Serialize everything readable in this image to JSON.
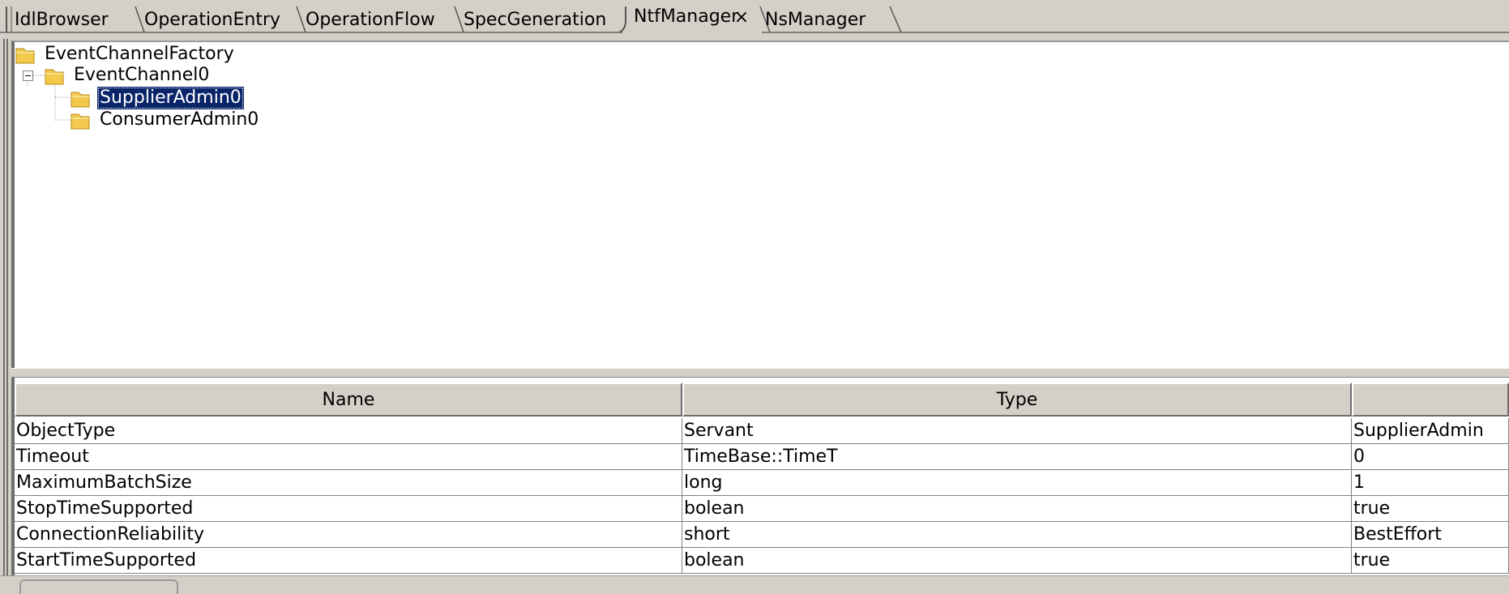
{
  "tabs": [
    {
      "label": "IdlBrowser",
      "active": false
    },
    {
      "label": "OperationEntry",
      "active": false
    },
    {
      "label": "OperationFlow",
      "active": false
    },
    {
      "label": "SpecGeneration",
      "active": false
    },
    {
      "label": "NtfManager",
      "active": true,
      "close_glyph": "×"
    },
    {
      "label": "NsManager",
      "active": false
    }
  ],
  "tree": {
    "root": "EventChannelFactory",
    "channel": "EventChannel0",
    "children": [
      "SupplierAdmin0",
      "ConsumerAdmin0"
    ],
    "selected": "SupplierAdmin0",
    "icon": "folder-icon"
  },
  "table": {
    "headers": [
      "Name",
      "Type",
      ""
    ],
    "rows": [
      [
        "ObjectType",
        "Servant",
        "SupplierAdmin"
      ],
      [
        "Timeout",
        "TimeBase::TimeT",
        "0"
      ],
      [
        "MaximumBatchSize",
        "long",
        "1"
      ],
      [
        "StopTimeSupported",
        "bolean",
        "true"
      ],
      [
        "ConnectionReliability",
        "short",
        "BestEffort"
      ],
      [
        "StartTimeSupported",
        "bolean",
        "true"
      ]
    ]
  },
  "colors": {
    "selection": "#0a246a",
    "folder": "#f2c94c",
    "chrome": "#d4d0c8"
  }
}
